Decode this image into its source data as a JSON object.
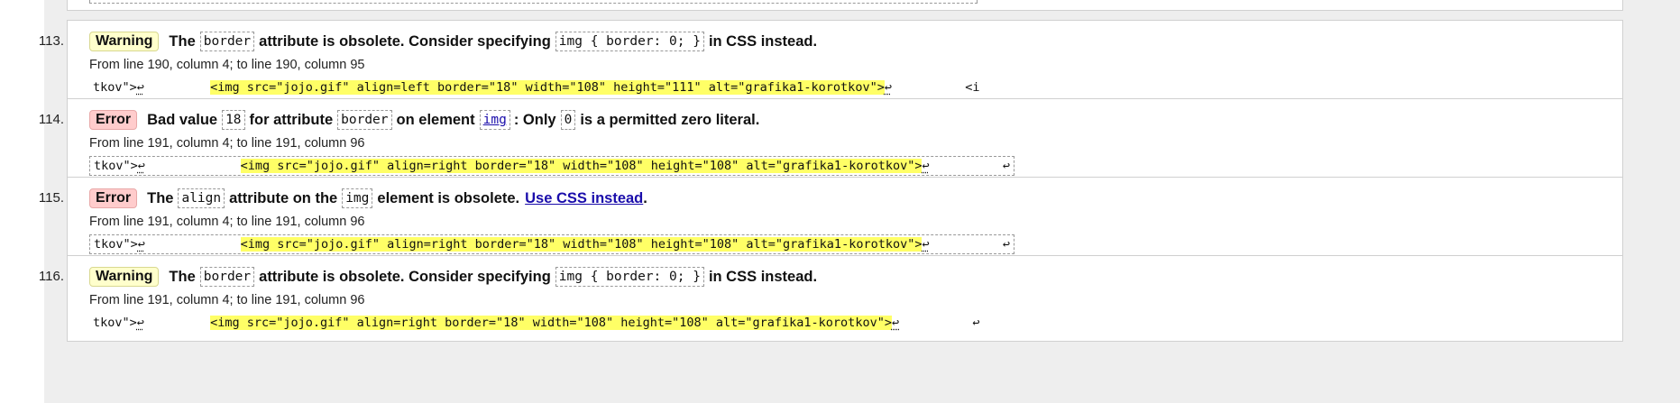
{
  "messages": [
    {
      "num": "113.",
      "type": "Warning",
      "parts": [
        {
          "t": "text",
          "v": "The"
        },
        {
          "t": "code",
          "v": "border"
        },
        {
          "t": "text",
          "v": "attribute is obsolete. Consider specifying"
        },
        {
          "t": "code",
          "v": "img { border: 0; }"
        },
        {
          "t": "text",
          "v": "in CSS instead."
        }
      ],
      "location": "From line 190, column 4; to line 190, column 95",
      "extract": {
        "boxed": false,
        "pre": "tkov\">",
        "pre_mark": "↩",
        "gap": "         ",
        "highlight": "<img src=\"jojo.gif\" align=left border=\"18\" width=\"108\" height=\"111\" alt=\"grafika1-korotkov\">",
        "hl_mark": "↩",
        "post": "          <i"
      }
    },
    {
      "num": "114.",
      "type": "Error",
      "parts": [
        {
          "t": "text",
          "v": "Bad value"
        },
        {
          "t": "code",
          "v": "18"
        },
        {
          "t": "text",
          "v": "for attribute"
        },
        {
          "t": "code",
          "v": "border"
        },
        {
          "t": "text",
          "v": "on element"
        },
        {
          "t": "codelink",
          "v": "img"
        },
        {
          "t": "text",
          "v": ": Only"
        },
        {
          "t": "code",
          "v": "0"
        },
        {
          "t": "text",
          "v": "is a permitted zero literal."
        }
      ],
      "location": "From line 191, column 4; to line 191, column 96",
      "extract": {
        "boxed": true,
        "pre": "tkov\">",
        "pre_mark": "↩",
        "gap": "             ",
        "highlight": "<img src=\"jojo.gif\" align=right border=\"18\" width=\"108\" height=\"108\" alt=\"grafika1-korotkov\">",
        "hl_mark": "↩",
        "post": "          ↩"
      }
    },
    {
      "num": "115.",
      "type": "Error",
      "parts": [
        {
          "t": "text",
          "v": "The"
        },
        {
          "t": "code",
          "v": "align"
        },
        {
          "t": "text",
          "v": "attribute on the"
        },
        {
          "t": "code",
          "v": "img"
        },
        {
          "t": "text",
          "v": "element is obsolete."
        },
        {
          "t": "link",
          "v": "Use CSS instead"
        },
        {
          "t": "text",
          "v": "."
        }
      ],
      "location": "From line 191, column 4; to line 191, column 96",
      "extract": {
        "boxed": true,
        "pre": "tkov\">",
        "pre_mark": "↩",
        "gap": "             ",
        "highlight": "<img src=\"jojo.gif\" align=right border=\"18\" width=\"108\" height=\"108\" alt=\"grafika1-korotkov\">",
        "hl_mark": "↩",
        "post": "          ↩"
      }
    },
    {
      "num": "116.",
      "type": "Warning",
      "parts": [
        {
          "t": "text",
          "v": "The"
        },
        {
          "t": "code",
          "v": "border"
        },
        {
          "t": "text",
          "v": "attribute is obsolete. Consider specifying"
        },
        {
          "t": "code",
          "v": "img { border: 0; }"
        },
        {
          "t": "text",
          "v": "in CSS instead."
        }
      ],
      "location": "From line 191, column 4; to line 191, column 96",
      "extract": {
        "boxed": false,
        "pre": "tkov\">",
        "pre_mark": "↩",
        "gap": "         ",
        "highlight": "<img src=\"jojo.gif\" align=right border=\"18\" width=\"108\" height=\"108\" alt=\"grafika1-korotkov\">",
        "hl_mark": "↩",
        "post": "          ↩"
      }
    }
  ]
}
